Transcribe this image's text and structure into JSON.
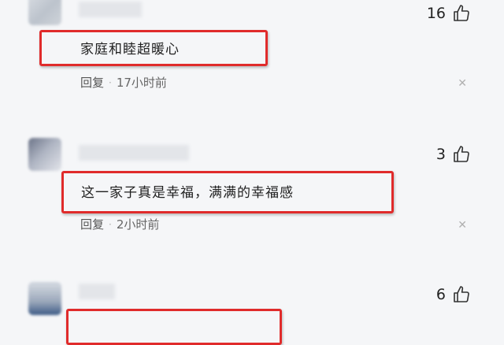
{
  "comments": [
    {
      "text": "家庭和睦超暖心",
      "likes": "16",
      "reply_label": "回复",
      "separator": "·",
      "time": "17小时前",
      "close_symbol": "✕"
    },
    {
      "text": "这一家子真是幸福，满满的幸福感",
      "likes": "3",
      "reply_label": "回复",
      "separator": "·",
      "time": "2小时前",
      "close_symbol": "✕"
    },
    {
      "likes": "6"
    }
  ],
  "colors": {
    "highlight_box": "#e02b2b",
    "background": "#f5f6f8"
  },
  "icons": {
    "like": "thumbs-up-icon",
    "close": "close-icon"
  }
}
